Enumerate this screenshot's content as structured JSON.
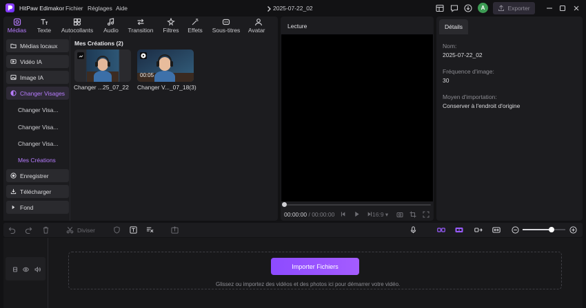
{
  "titlebar": {
    "app_name": "HitPaw Edimakor",
    "menus": [
      "Fichier",
      "Réglages",
      "Aide"
    ],
    "document_title": "2025-07-22_02",
    "avatar_letter": "A",
    "export_label": "Exporter"
  },
  "tabs": [
    {
      "label": "Médias",
      "icon": "media-icon",
      "active": true
    },
    {
      "label": "Texte",
      "icon": "text-icon"
    },
    {
      "label": "Autocollants",
      "icon": "sticker-icon"
    },
    {
      "label": "Audio",
      "icon": "music-icon"
    },
    {
      "label": "Transition",
      "icon": "transition-icon"
    },
    {
      "label": "Filtres",
      "icon": "filter-icon"
    },
    {
      "label": "Effets",
      "icon": "effects-icon"
    },
    {
      "label": "Sous-titres",
      "icon": "subtitle-icon"
    },
    {
      "label": "Avatar",
      "icon": "avatar-icon"
    }
  ],
  "sidebar": {
    "items": [
      {
        "label": "Médias locaux",
        "icon": "folder-icon"
      },
      {
        "label": "Vidéo IA",
        "icon": "ai-video-icon"
      },
      {
        "label": "Image IA",
        "icon": "ai-image-icon"
      },
      {
        "label": "Changer Visages",
        "icon": "face-swap-icon",
        "active": true
      }
    ],
    "subitems": [
      {
        "label": "Changer Visa..."
      },
      {
        "label": "Changer Visa..."
      },
      {
        "label": "Changer Visa..."
      },
      {
        "label": "Mes Créations",
        "active": true
      }
    ],
    "bottom_items": [
      {
        "label": "Enregistrer",
        "icon": "record-icon"
      },
      {
        "label": "Télécharger",
        "icon": "download-icon"
      },
      {
        "label": "Fond",
        "icon": "background-icon"
      }
    ]
  },
  "media_grid": {
    "title": "Mes Créations (2)",
    "items": [
      {
        "label": "Changer ...25_07_22",
        "kind": "image"
      },
      {
        "label": "Changer V..._07_18(3)",
        "kind": "video",
        "duration": "00:05"
      }
    ]
  },
  "preview": {
    "title": "Lecture",
    "time_current": "00:00:00",
    "time_total": "00:00:00",
    "ratio": "16:9"
  },
  "details": {
    "tab_label": "Détails",
    "fields": [
      {
        "label": "Nom:",
        "value": "2025-07-22_02"
      },
      {
        "label": "Fréquence d'image:",
        "value": "30"
      },
      {
        "label": "Moyen d'importation:",
        "value": "Conserver à l'endroit d'origine"
      }
    ]
  },
  "timeline": {
    "split_label": "Diviser",
    "zoom_level": 0.67,
    "import_button": "Importer Fichiers",
    "drop_hint": "Glissez ou importez des vidéos et des photos ici pour démarrer votre vidéo."
  }
}
